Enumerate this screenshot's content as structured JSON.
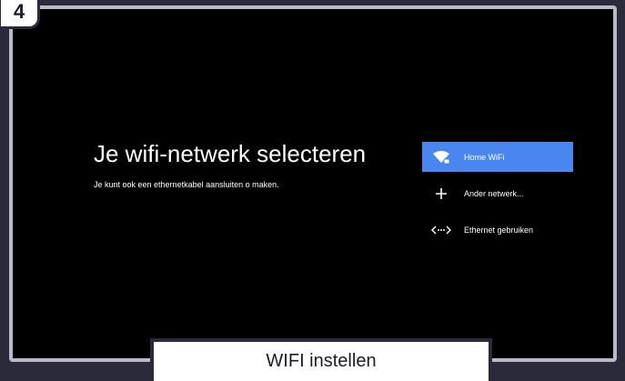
{
  "step_number": "4",
  "screen": {
    "title": "Je wifi-netwerk selecteren",
    "subtitle": "Je kunt ook een ethernetkabel aansluiten o maken."
  },
  "menu": {
    "items": [
      {
        "label": "Home WiFi",
        "icon": "wifi-lock-icon",
        "selected": true
      },
      {
        "label": "Ander netwerk...",
        "icon": "plus-icon",
        "selected": false
      },
      {
        "label": "Ethernet gebruiken",
        "icon": "ethernet-icon",
        "selected": false
      }
    ]
  },
  "caption": "WIFI instellen",
  "colors": {
    "selected": "#4a86f0",
    "background": "#000000",
    "frame": "#2b2a3a"
  }
}
